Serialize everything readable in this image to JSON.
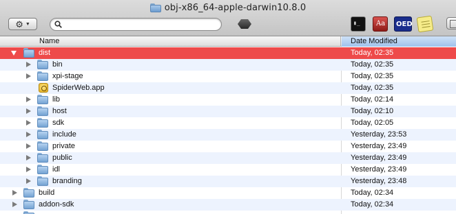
{
  "window": {
    "title": "obj-x86_64-apple-darwin10.8.0",
    "title_icon": "folder-icon"
  },
  "toolbar": {
    "action_icon": "gear-icon",
    "search_value": "",
    "search_placeholder": "",
    "eject_icon": "eject-icon",
    "apps": [
      {
        "name": "terminal-app-icon",
        "glyph": "▮_"
      },
      {
        "name": "dictionary-app-icon",
        "glyph": "Aa"
      },
      {
        "name": "oed-app-icon",
        "glyph": "OED"
      },
      {
        "name": "stickies-app-icon",
        "glyph": ""
      }
    ]
  },
  "columns": {
    "name": "Name",
    "date_modified": "Date Modified"
  },
  "colors": {
    "selection": "#ee4a4a",
    "date_header": "#9fc2ec",
    "alt_row": "#edf3fe"
  },
  "rows": [
    {
      "name": "dist",
      "date": "Today, 02:35",
      "level": 0,
      "kind": "folder",
      "expanded": true,
      "selected": true
    },
    {
      "name": "bin",
      "date": "Today, 02:35",
      "level": 1,
      "kind": "folder",
      "expanded": false,
      "selected": false
    },
    {
      "name": "xpi-stage",
      "date": "Today, 02:35",
      "level": 1,
      "kind": "folder",
      "expanded": false,
      "selected": false
    },
    {
      "name": "SpiderWeb.app",
      "date": "Today, 02:35",
      "level": 1,
      "kind": "app",
      "expanded": false,
      "selected": false
    },
    {
      "name": "lib",
      "date": "Today, 02:14",
      "level": 1,
      "kind": "folder",
      "expanded": false,
      "selected": false
    },
    {
      "name": "host",
      "date": "Today, 02:10",
      "level": 1,
      "kind": "folder",
      "expanded": false,
      "selected": false
    },
    {
      "name": "sdk",
      "date": "Today, 02:05",
      "level": 1,
      "kind": "folder",
      "expanded": false,
      "selected": false
    },
    {
      "name": "include",
      "date": "Yesterday, 23:53",
      "level": 1,
      "kind": "folder",
      "expanded": false,
      "selected": false
    },
    {
      "name": "private",
      "date": "Yesterday, 23:49",
      "level": 1,
      "kind": "folder",
      "expanded": false,
      "selected": false
    },
    {
      "name": "public",
      "date": "Yesterday, 23:49",
      "level": 1,
      "kind": "folder",
      "expanded": false,
      "selected": false
    },
    {
      "name": "idl",
      "date": "Yesterday, 23:49",
      "level": 1,
      "kind": "folder",
      "expanded": false,
      "selected": false
    },
    {
      "name": "branding",
      "date": "Yesterday, 23:48",
      "level": 1,
      "kind": "folder",
      "expanded": false,
      "selected": false
    },
    {
      "name": "build",
      "date": "Today, 02:34",
      "level": 0,
      "kind": "folder",
      "expanded": false,
      "selected": false
    },
    {
      "name": "addon-sdk",
      "date": "Today, 02:34",
      "level": 0,
      "kind": "folder",
      "expanded": false,
      "selected": false
    },
    {
      "name": "",
      "date": "",
      "level": 0,
      "kind": "folder",
      "expanded": false,
      "selected": false
    }
  ]
}
